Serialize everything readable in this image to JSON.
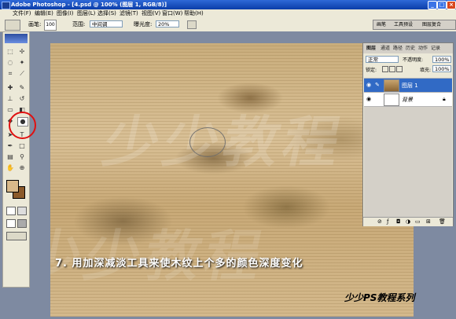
{
  "title_bar": {
    "title": "Adobe Photoshop - [4.psd @ 100% (图层 1, RGB/8)]",
    "min": "_",
    "max": "□",
    "close": "×"
  },
  "menu": [
    "文件(F)",
    "编辑(E)",
    "图像(I)",
    "图层(L)",
    "选择(S)",
    "滤镜(T)",
    "视图(V)",
    "窗口(W)",
    "帮助(H)"
  ],
  "options_bar": {
    "brush_label": "画笔:",
    "brush_size": "100",
    "range_label": "范围:",
    "range_value": "中间调",
    "exposure_label": "曝光度:",
    "exposure_value": "20%",
    "palette_tabs": [
      "画笔",
      "工具预设",
      "图层复合"
    ]
  },
  "layers_panel": {
    "tabs": [
      "图层",
      "通道",
      "路径",
      "历史",
      "动作",
      "记录"
    ],
    "blend_mode": "正常",
    "opacity_label": "不透明度:",
    "opacity_value": "100%",
    "lock_label": "锁定:",
    "fill_label": "填充:",
    "fill_value": "100%",
    "layers": [
      {
        "name": "图层 1",
        "selected": true
      },
      {
        "name": "背景",
        "selected": false
      }
    ]
  },
  "overlay": {
    "instruction": "7. 用加深减淡工具来使木纹上个多的颜色深度变化",
    "watermark": "少少教程",
    "series": "少少PS教程系列"
  },
  "colors": {
    "titlebar": "#0a3ca8",
    "chrome": "#ece9d8",
    "highlight": "#e01010",
    "selected_layer": "#316ac5"
  }
}
